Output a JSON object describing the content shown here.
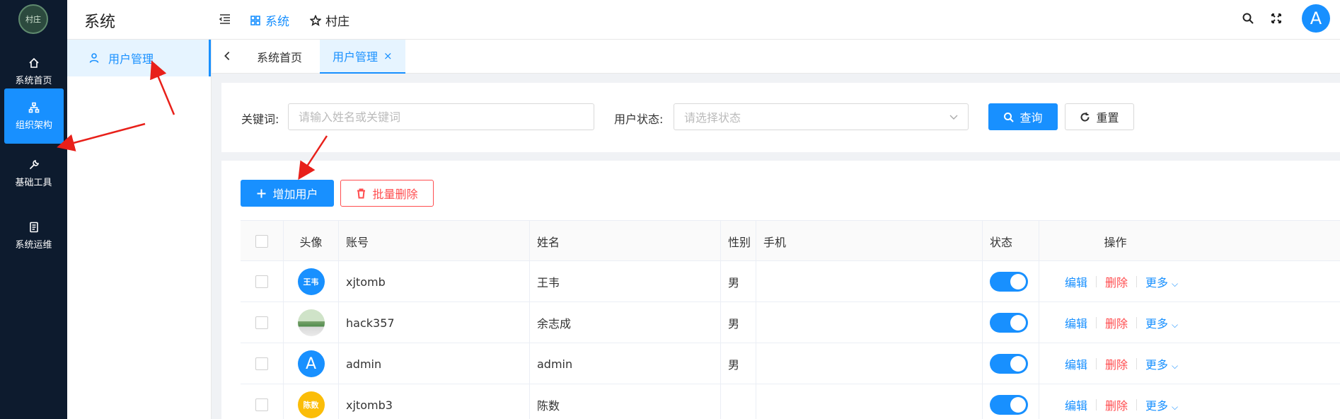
{
  "app": {
    "logo_text": "村庄",
    "title": "系统"
  },
  "rail": {
    "items": [
      {
        "label": "系统首页",
        "icon": "home-icon",
        "active": false
      },
      {
        "label": "组织架构",
        "icon": "org-chart-icon",
        "active": true
      },
      {
        "label": "基础工具",
        "icon": "wrench-icon",
        "active": false
      },
      {
        "label": "系统运维",
        "icon": "document-icon",
        "active": false
      }
    ]
  },
  "submenu": {
    "items": [
      {
        "label": "用户管理",
        "icon": "user-icon",
        "active": true
      }
    ]
  },
  "header": {
    "nav": [
      {
        "label": "系统",
        "icon": "grid-icon",
        "active": true
      },
      {
        "label": "村庄",
        "icon": "star-icon",
        "active": false
      }
    ],
    "user_initial": "A"
  },
  "tabs": {
    "items": [
      {
        "label": "系统首页",
        "active": false
      },
      {
        "label": "用户管理",
        "active": true,
        "close": "×"
      }
    ]
  },
  "search": {
    "keyword_label": "关键词:",
    "keyword_placeholder": "请输入姓名或关键词",
    "status_label": "用户状态:",
    "status_placeholder": "请选择状态",
    "query_button": "查询",
    "reset_button": "重置"
  },
  "toolbar": {
    "add_button": "增加用户",
    "batch_delete_button": "批量删除"
  },
  "table": {
    "columns": [
      "头像",
      "账号",
      "姓名",
      "性别",
      "手机",
      "状态",
      "操作"
    ],
    "actions": {
      "edit": "编辑",
      "delete": "删除",
      "more": "更多"
    },
    "rows": [
      {
        "avatar": {
          "type": "text",
          "text": "王韦",
          "color": "#1890ff"
        },
        "account": "xjtomb",
        "name": "王韦",
        "gender": "男",
        "phone": "",
        "enabled": true
      },
      {
        "avatar": {
          "type": "image",
          "text": "",
          "color": "#7aa36e"
        },
        "account": "hack357",
        "name": "余志成",
        "gender": "男",
        "phone": "",
        "enabled": true
      },
      {
        "avatar": {
          "type": "text-big",
          "text": "A",
          "color": "#1890ff"
        },
        "account": "admin",
        "name": "admin",
        "gender": "男",
        "phone": "",
        "enabled": true
      },
      {
        "avatar": {
          "type": "text",
          "text": "陈数",
          "color": "#fbbd08"
        },
        "account": "xjtomb3",
        "name": "陈数",
        "gender": "",
        "phone": "",
        "enabled": true
      }
    ]
  },
  "colors": {
    "primary": "#1890ff",
    "danger": "#ff4d4f",
    "rail_bg": "#0d1b2e"
  }
}
